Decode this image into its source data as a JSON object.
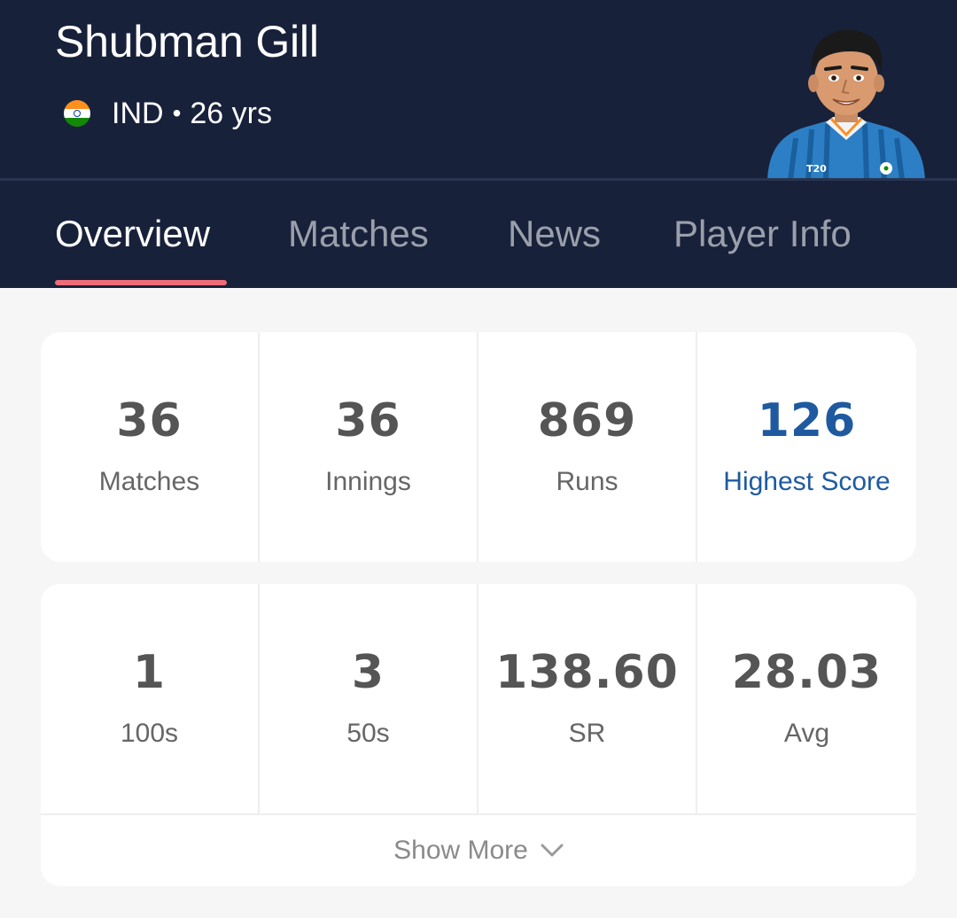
{
  "player": {
    "name": "Shubman Gill",
    "country": "IND",
    "age": "26 yrs",
    "separator": "•",
    "flag_icon": "india-flag-icon",
    "avatar_icon": "player-avatar-icon"
  },
  "tabs": [
    {
      "label": "Overview",
      "active": true
    },
    {
      "label": "Matches",
      "active": false
    },
    {
      "label": "News",
      "active": false
    },
    {
      "label": "Player Info",
      "active": false
    }
  ],
  "stats_row1": [
    {
      "value": "36",
      "label": "Matches"
    },
    {
      "value": "36",
      "label": "Innings"
    },
    {
      "value": "869",
      "label": "Runs"
    },
    {
      "value": "126",
      "label": "Highest Score",
      "highlight": true
    }
  ],
  "stats_row2": [
    {
      "value": "1",
      "label": "100s"
    },
    {
      "value": "3",
      "label": "50s"
    },
    {
      "value": "138.60",
      "label": "SR"
    },
    {
      "value": "28.03",
      "label": "Avg"
    }
  ],
  "show_more": {
    "label": "Show More",
    "icon": "chevron-down-icon"
  },
  "colors": {
    "header_bg": "#18213a",
    "tab_indicator": "#ef6b78",
    "highlight": "#1f5aa0",
    "page_bg": "#f6f6f7"
  }
}
